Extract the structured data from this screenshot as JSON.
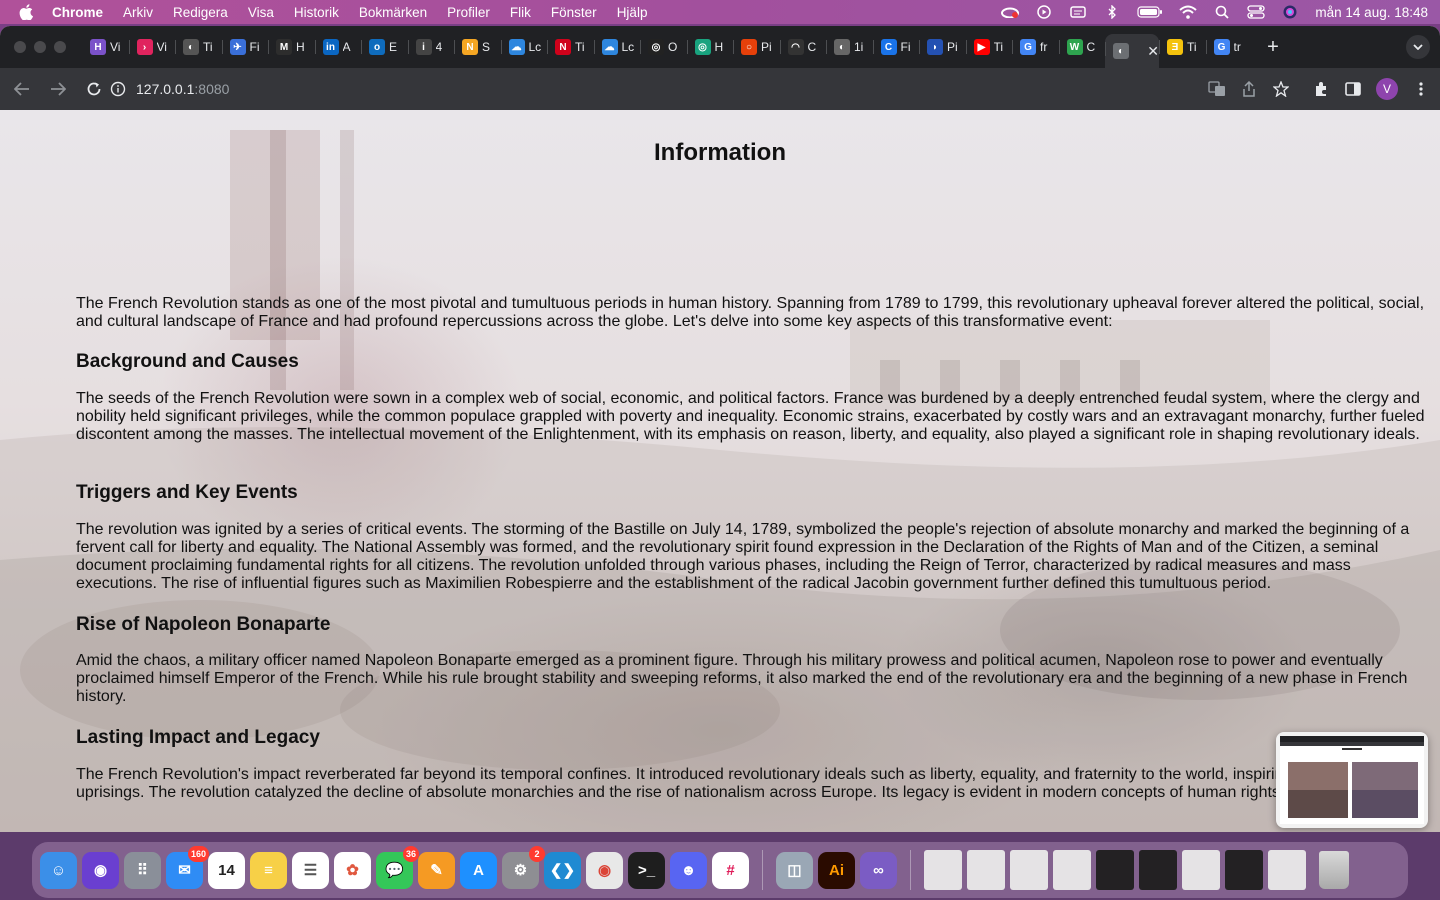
{
  "menubar": {
    "app_name": "Chrome",
    "items": [
      "Arkiv",
      "Redigera",
      "Visa",
      "Historik",
      "Bokmärken",
      "Profiler",
      "Flik",
      "Fönster",
      "Hjälp"
    ],
    "clock": "mån 14 aug.  18:48"
  },
  "browser": {
    "tabs": [
      {
        "label": "Vi",
        "color": "#7b52c9",
        "glyph": "H"
      },
      {
        "label": "Vi",
        "color": "#e0245e",
        "glyph": "›"
      },
      {
        "label": "Ti",
        "color": "#555555",
        "glyph": "◐"
      },
      {
        "label": "Fi",
        "color": "#3a6fd8",
        "glyph": "✈"
      },
      {
        "label": "H",
        "color": "#2d2d2d",
        "glyph": "M"
      },
      {
        "label": "A",
        "color": "#0a66c2",
        "glyph": "in"
      },
      {
        "label": "E",
        "color": "#0f6cbd",
        "glyph": "o"
      },
      {
        "label": "4",
        "color": "#444444",
        "glyph": "i"
      },
      {
        "label": "S",
        "color": "#f5a623",
        "glyph": "N"
      },
      {
        "label": "Lc",
        "color": "#2e86de",
        "glyph": "☁"
      },
      {
        "label": "Ti",
        "color": "#d0021b",
        "glyph": "N"
      },
      {
        "label": "Lc",
        "color": "#2e86de",
        "glyph": "☁"
      },
      {
        "label": "O",
        "color": "#222222",
        "glyph": "◎"
      },
      {
        "label": "H",
        "color": "#19a37f",
        "glyph": "◎"
      },
      {
        "label": "Pi",
        "color": "#e6400a",
        "glyph": "○"
      },
      {
        "label": "C",
        "color": "#333333",
        "glyph": "◠"
      },
      {
        "label": "1i",
        "color": "#666666",
        "glyph": "◐"
      },
      {
        "label": "Fi",
        "color": "#1a73e8",
        "glyph": "C"
      },
      {
        "label": "Pi",
        "color": "#2451b2",
        "glyph": "◗"
      },
      {
        "label": "Ti",
        "color": "#ff0000",
        "glyph": "▶"
      },
      {
        "label": "fr",
        "color": "#4285f4",
        "glyph": "G"
      },
      {
        "label": "C",
        "color": "#2ea44f",
        "glyph": "W"
      },
      {
        "label": "",
        "color": "#6c6f73",
        "glyph": "◐",
        "active": true
      },
      {
        "label": "Ti",
        "color": "#f4c20d",
        "glyph": "Ǝ"
      },
      {
        "label": "tr",
        "color": "#4285f4",
        "glyph": "G"
      }
    ],
    "url_host": "127.0.0.1",
    "url_port": ":8080",
    "profile_initial": "V"
  },
  "page": {
    "title": "Information",
    "intro": "The French Revolution stands as one of the most pivotal and tumultuous periods in human history. Spanning from 1789 to 1799, this revolutionary upheaval forever altered the political, social, and cultural landscape of France and had profound repercussions across the globe. Let's delve into some key aspects of this transformative event:",
    "sections": [
      {
        "heading": "Background and Causes",
        "body": "The seeds of the French Revolution were sown in a complex web of social, economic, and political factors. France was burdened by a deeply entrenched feudal system, where the clergy and nobility held significant privileges, while the common populace grappled with poverty and inequality. Economic strains, exacerbated by costly wars and an extravagant monarchy, further fueled discontent among the masses. The intellectual movement of the Enlightenment, with its emphasis on reason, liberty, and equality, also played a significant role in shaping revolutionary ideals."
      },
      {
        "heading": "Triggers and Key Events",
        "body": "The revolution was ignited by a series of critical events. The storming of the Bastille on July 14, 1789, symbolized the people's rejection of absolute monarchy and marked the beginning of a fervent call for liberty and equality. The National Assembly was formed, and the revolutionary spirit found expression in the Declaration of the Rights of Man and of the Citizen, a seminal document proclaiming fundamental rights for all citizens. The revolution unfolded through various phases, including the Reign of Terror, characterized by radical measures and mass executions. The rise of influential figures such as Maximilien Robespierre and the establishment of the radical Jacobin government further defined this tumultuous period."
      },
      {
        "heading": "Rise of Napoleon Bonaparte",
        "body": "Amid the chaos, a military officer named Napoleon Bonaparte emerged as a prominent figure. Through his military prowess and political acumen, Napoleon rose to power and eventually proclaimed himself Emperor of the French. While his rule brought stability and sweeping reforms, it also marked the end of the revolutionary era and the beginning of a new phase in French history."
      },
      {
        "heading": "Lasting Impact and Legacy",
        "body": "The French Revolution's impact reverberated far beyond its temporal confines. It introduced revolutionary ideals such as liberty, equality, and fraternity to the world, inspiring movements and uprisings. The revolution catalyzed the decline of absolute monarchies and the rise of nationalism across Europe. Its legacy is evident in modern concepts of human rights, and the rule of law."
      }
    ]
  },
  "dock": {
    "apps": [
      {
        "name": "finder",
        "color": "#3b8fe8",
        "glyph": "☺"
      },
      {
        "name": "siri",
        "color": "#6a3fd0",
        "glyph": "◉"
      },
      {
        "name": "launchpad",
        "color": "#8a8f99",
        "glyph": "⠿"
      },
      {
        "name": "mail",
        "color": "#2f8cf5",
        "glyph": "✉",
        "badge": "160"
      },
      {
        "name": "calendar",
        "color": "#ffffff",
        "glyph": "14",
        "text": "#222"
      },
      {
        "name": "notes",
        "color": "#f7d047",
        "glyph": "≡"
      },
      {
        "name": "reminders",
        "color": "#ffffff",
        "glyph": "☰",
        "text": "#555"
      },
      {
        "name": "photos",
        "color": "#ffffff",
        "glyph": "✿",
        "text": "#e0583f"
      },
      {
        "name": "messages",
        "color": "#34c759",
        "glyph": "💬",
        "badge": "36"
      },
      {
        "name": "pages",
        "color": "#f59a23",
        "glyph": "✎"
      },
      {
        "name": "app-store",
        "color": "#1e90ff",
        "glyph": "A"
      },
      {
        "name": "system-settings",
        "color": "#8e8e93",
        "glyph": "⚙",
        "badge": "2"
      },
      {
        "name": "vscode",
        "color": "#1f8ad2",
        "glyph": "❮❯"
      },
      {
        "name": "chrome",
        "color": "#e8e8e8",
        "glyph": "◉",
        "text": "#db4437"
      },
      {
        "name": "terminal",
        "color": "#1e1e1e",
        "glyph": ">_"
      },
      {
        "name": "discord",
        "color": "#5865f2",
        "glyph": "☻"
      },
      {
        "name": "slack",
        "color": "#ffffff",
        "glyph": "#",
        "text": "#e01e5a"
      }
    ],
    "apps2": [
      {
        "name": "preview",
        "color": "#9aa7b5",
        "glyph": "◫"
      },
      {
        "name": "illustrator",
        "color": "#2a0b00",
        "glyph": "Ai",
        "text": "#ff9a00"
      },
      {
        "name": "visual-studio",
        "color": "#7b5cc4",
        "glyph": "∞"
      }
    ]
  }
}
